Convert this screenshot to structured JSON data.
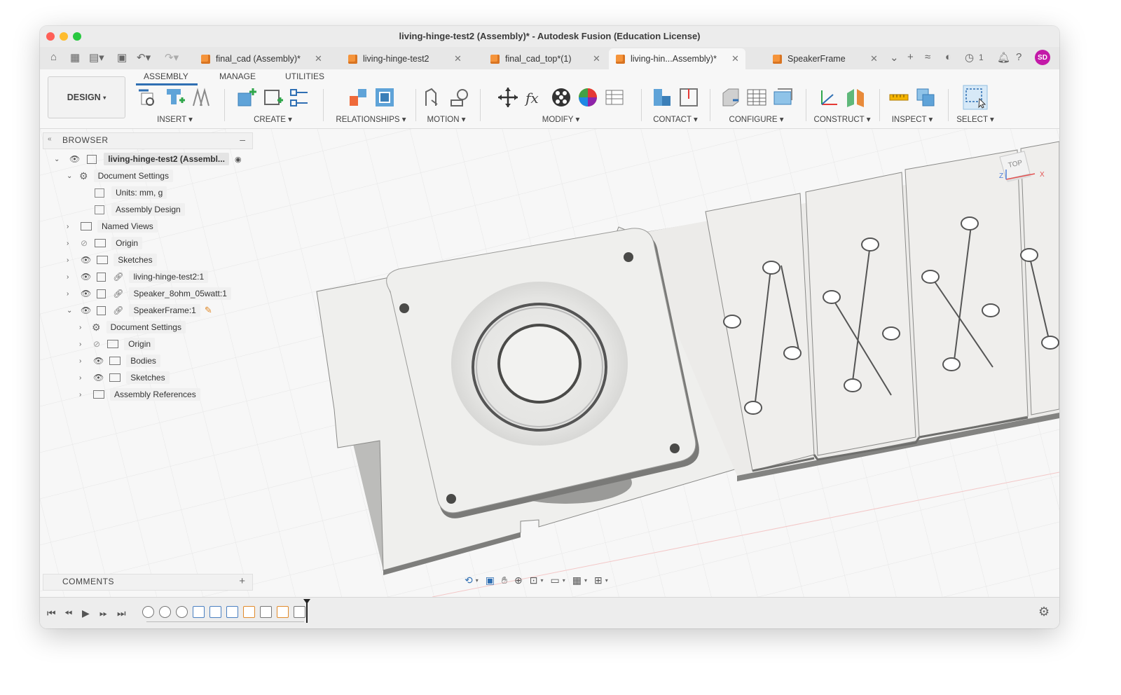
{
  "window": {
    "title": "living-hinge-test2 (Assembly)* - Autodesk Fusion (Education License)",
    "traffic_lights": [
      "#ff5f57",
      "#febc2e",
      "#28c840"
    ]
  },
  "tabs": [
    {
      "label": "final_cad (Assembly)*",
      "active": false
    },
    {
      "label": "living-hinge-test2",
      "active": false
    },
    {
      "label": "final_cad_top*(1)",
      "active": false
    },
    {
      "label": "living-hin...Assembly)*",
      "active": true
    },
    {
      "label": "SpeakerFrame",
      "active": false
    }
  ],
  "tabbar_right": {
    "jobs_count": "1",
    "avatar_initials": "SD"
  },
  "toolbar": {
    "workspace": "DESIGN",
    "subtabs": [
      "ASSEMBLY",
      "MANAGE",
      "UTILITIES"
    ],
    "groups": [
      {
        "label": "INSERT"
      },
      {
        "label": "CREATE"
      },
      {
        "label": "RELATIONSHIPS"
      },
      {
        "label": "MOTION"
      },
      {
        "label": "MODIFY"
      },
      {
        "label": "CONTACT"
      },
      {
        "label": "CONFIGURE"
      },
      {
        "label": "CONSTRUCT"
      },
      {
        "label": "INSPECT"
      },
      {
        "label": "SELECT"
      }
    ]
  },
  "browser": {
    "title": "BROWSER",
    "items": [
      {
        "label": "living-hinge-test2 (Assembl..."
      },
      {
        "label": "Document Settings"
      },
      {
        "label": "Units: mm, g"
      },
      {
        "label": "Assembly Design"
      },
      {
        "label": "Named Views"
      },
      {
        "label": "Origin"
      },
      {
        "label": "Sketches"
      },
      {
        "label": "living-hinge-test2:1"
      },
      {
        "label": "Speaker_8ohm_05watt:1"
      },
      {
        "label": "SpeakerFrame:1"
      },
      {
        "label": "Document Settings"
      },
      {
        "label": "Origin"
      },
      {
        "label": "Bodies"
      },
      {
        "label": "Sketches"
      },
      {
        "label": "Assembly References"
      }
    ]
  },
  "comments": {
    "title": "COMMENTS"
  },
  "viewcube": {
    "face": "TOP",
    "axis_z": "Z",
    "axis_x": "X"
  },
  "colors": {
    "accent": "#2f6fb3",
    "tab_cube": "#f5943b",
    "avatar": "#c319a8"
  }
}
